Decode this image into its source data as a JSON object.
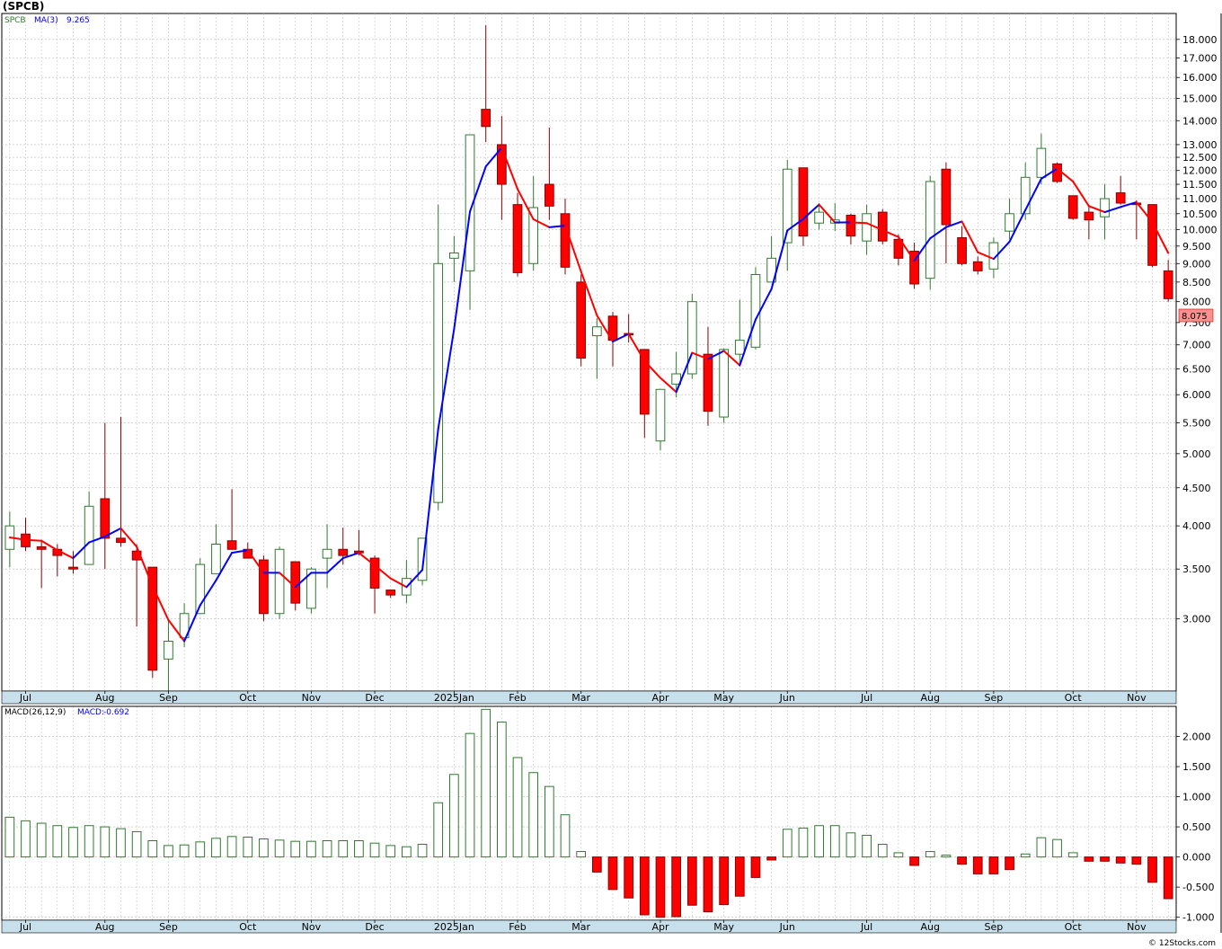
{
  "header": {
    "title": "(SPCB)"
  },
  "legend": {
    "symbol": "SPCB",
    "ma_label": "MA(3)",
    "ma_value": "9.265"
  },
  "macd_legend": {
    "label": "MACD(26,12,9)",
    "macd_label": "MACD:",
    "macd_value": "-0.692"
  },
  "last_price_label": "8.075",
  "footer": {
    "credit": "© 12Stocks.com"
  },
  "colors": {
    "up": "#2f7a2f",
    "down": "#ff0000",
    "ma_up": "#0000ff",
    "ma_down": "#ff0000",
    "grid": "#bbbbbb",
    "axis_bar": "#c8e0ec",
    "price_tag": "#ff9090"
  },
  "chart_data": [
    {
      "type": "candlestick",
      "title": "(SPCB)",
      "scale": "log",
      "ylim": [
        2.4,
        19.5
      ],
      "y_ticks": [
        "3.000",
        "3.500",
        "4.000",
        "4.500",
        "5.000",
        "5.500",
        "6.000",
        "6.500",
        "7.000",
        "7.500",
        "8.000",
        "8.500",
        "9.000",
        "9.500",
        "10.000",
        "10.500",
        "11.000",
        "11.500",
        "12.000",
        "12.500",
        "13.000",
        "14.000",
        "15.000",
        "16.000",
        "17.000",
        "18.000"
      ],
      "x_month_labels": [
        "Jul",
        "Aug",
        "Sep",
        "Oct",
        "Nov",
        "Dec",
        "2025Jan",
        "Feb",
        "Mar",
        "Apr",
        "May",
        "Jun",
        "Jul",
        "Aug",
        "Sep",
        "Oct",
        "Nov"
      ],
      "x_month_week_index": [
        1,
        6,
        10,
        15,
        19,
        23,
        28,
        32,
        36,
        41,
        45,
        49,
        54,
        58,
        62,
        67,
        71
      ],
      "grid": true,
      "series": [
        {
          "name": "SPCB",
          "ohlc": [
            [
              3.72,
              4.18,
              3.52,
              4.0
            ],
            [
              3.9,
              4.1,
              3.7,
              3.75
            ],
            [
              3.75,
              3.83,
              3.3,
              3.72
            ],
            [
              3.72,
              3.78,
              3.42,
              3.65
            ],
            [
              3.52,
              3.7,
              3.45,
              3.5
            ],
            [
              3.55,
              4.45,
              3.55,
              4.25
            ],
            [
              4.35,
              5.5,
              3.5,
              3.85
            ],
            [
              3.85,
              5.6,
              3.75,
              3.8
            ],
            [
              3.7,
              3.78,
              2.93,
              3.6
            ],
            [
              3.52,
              3.52,
              2.5,
              2.56
            ],
            [
              2.65,
              3.0,
              2.4,
              2.8
            ],
            [
              2.83,
              3.15,
              2.75,
              3.05
            ],
            [
              3.05,
              3.62,
              3.05,
              3.55
            ],
            [
              3.45,
              4.02,
              3.45,
              3.78
            ],
            [
              3.82,
              4.48,
              3.72,
              3.72
            ],
            [
              3.72,
              3.8,
              3.65,
              3.62
            ],
            [
              3.6,
              3.65,
              2.98,
              3.05
            ],
            [
              3.05,
              3.75,
              3.0,
              3.72
            ],
            [
              3.58,
              3.58,
              3.08,
              3.15
            ],
            [
              3.1,
              3.52,
              3.05,
              3.5
            ],
            [
              3.62,
              4.02,
              3.3,
              3.72
            ],
            [
              3.72,
              3.98,
              3.55,
              3.65
            ],
            [
              3.7,
              3.95,
              3.65,
              3.68
            ],
            [
              3.62,
              3.65,
              3.05,
              3.3
            ],
            [
              3.28,
              3.28,
              3.2,
              3.23
            ],
            [
              3.23,
              3.6,
              3.15,
              3.4
            ],
            [
              3.38,
              3.85,
              3.33,
              3.85
            ],
            [
              4.3,
              10.8,
              4.2,
              9.0
            ],
            [
              9.15,
              9.8,
              8.5,
              9.3
            ],
            [
              8.8,
              13.4,
              7.8,
              13.4
            ],
            [
              14.5,
              18.8,
              13.1,
              13.75
            ],
            [
              13.0,
              14.2,
              10.3,
              11.5
            ],
            [
              10.8,
              11.2,
              8.65,
              8.75
            ],
            [
              9.0,
              11.8,
              8.8,
              10.7
            ],
            [
              11.5,
              13.7,
              10.3,
              10.75
            ],
            [
              10.5,
              11.0,
              8.7,
              8.9
            ],
            [
              8.5,
              8.7,
              6.55,
              6.72
            ],
            [
              7.2,
              7.6,
              6.3,
              7.4
            ],
            [
              7.65,
              7.75,
              6.55,
              7.1
            ],
            [
              7.25,
              7.7,
              7.05,
              7.22
            ],
            [
              6.9,
              6.9,
              5.25,
              5.65
            ],
            [
              5.2,
              6.1,
              5.05,
              6.1
            ],
            [
              6.2,
              6.85,
              5.95,
              6.4
            ],
            [
              6.4,
              8.2,
              6.3,
              8.0
            ],
            [
              6.8,
              7.4,
              5.45,
              5.7
            ],
            [
              5.6,
              6.92,
              5.5,
              6.9
            ],
            [
              6.8,
              8.05,
              6.55,
              7.1
            ],
            [
              6.95,
              8.9,
              6.9,
              8.7
            ],
            [
              8.5,
              9.8,
              8.5,
              9.15
            ],
            [
              9.6,
              12.4,
              8.8,
              12.05
            ],
            [
              12.1,
              12.1,
              9.5,
              9.8
            ],
            [
              10.2,
              10.85,
              10.0,
              10.55
            ],
            [
              10.2,
              10.85,
              9.95,
              10.3
            ],
            [
              10.45,
              10.5,
              9.55,
              9.8
            ],
            [
              9.65,
              10.8,
              9.25,
              10.5
            ],
            [
              10.55,
              10.65,
              9.55,
              9.65
            ],
            [
              9.7,
              9.85,
              8.95,
              9.15
            ],
            [
              9.35,
              9.6,
              8.32,
              8.45
            ],
            [
              8.6,
              11.8,
              8.3,
              11.6
            ],
            [
              12.05,
              12.3,
              9.0,
              10.15
            ],
            [
              9.75,
              10.1,
              8.95,
              9.0
            ],
            [
              9.05,
              9.2,
              8.7,
              8.8
            ],
            [
              8.85,
              9.75,
              8.6,
              9.6
            ],
            [
              9.95,
              11.0,
              9.7,
              10.5
            ],
            [
              10.5,
              12.3,
              10.3,
              11.75
            ],
            [
              11.75,
              13.45,
              11.5,
              12.85
            ],
            [
              12.25,
              12.3,
              11.55,
              11.6
            ],
            [
              11.1,
              11.1,
              10.3,
              10.35
            ],
            [
              10.55,
              10.75,
              9.7,
              10.3
            ],
            [
              10.4,
              11.5,
              9.7,
              11.0
            ],
            [
              11.2,
              11.8,
              10.8,
              10.85
            ],
            [
              10.85,
              10.95,
              9.7,
              10.8
            ],
            [
              10.8,
              10.8,
              8.9,
              8.95
            ],
            [
              8.8,
              9.1,
              8.0,
              8.075
            ]
          ]
        },
        {
          "name": "MA(3)",
          "values": [
            3.86,
            3.83,
            3.82,
            3.71,
            3.62,
            3.8,
            3.87,
            3.97,
            3.75,
            3.32,
            2.99,
            2.8,
            3.13,
            3.38,
            3.68,
            3.71,
            3.46,
            3.46,
            3.31,
            3.46,
            3.46,
            3.62,
            3.68,
            3.54,
            3.4,
            3.31,
            3.49,
            5.4,
            7.35,
            10.57,
            12.15,
            12.88,
            11.33,
            10.32,
            10.07,
            10.12,
            8.78,
            7.67,
            7.07,
            7.24,
            6.66,
            6.32,
            6.05,
            6.83,
            6.7,
            6.87,
            6.57,
            7.57,
            8.32,
            9.97,
            10.33,
            10.8,
            10.22,
            10.22,
            10.2,
            9.98,
            9.77,
            9.08,
            9.73,
            10.07,
            10.25,
            9.32,
            9.13,
            9.63,
            10.62,
            11.7,
            12.07,
            11.6,
            10.75,
            10.55,
            10.72,
            10.88,
            10.23,
            9.3
          ]
        }
      ]
    },
    {
      "type": "bar",
      "title": "MACD(26,12,9)",
      "ylim": [
        -1.05,
        2.5
      ],
      "y_ticks": [
        "2.000",
        "1.500",
        "1.000",
        "0.500",
        "0.000",
        "-0.500",
        "-1.000"
      ],
      "x_month_labels": [
        "Jul",
        "Aug",
        "Sep",
        "Oct",
        "Nov",
        "Dec",
        "2025Jan",
        "Feb",
        "Mar",
        "Apr",
        "May",
        "Jun",
        "Jul",
        "Aug",
        "Sep",
        "Oct",
        "Nov"
      ],
      "grid": true,
      "series": [
        {
          "name": "MACD",
          "values": [
            0.66,
            0.6,
            0.56,
            0.52,
            0.49,
            0.52,
            0.5,
            0.47,
            0.42,
            0.27,
            0.19,
            0.2,
            0.25,
            0.31,
            0.34,
            0.33,
            0.3,
            0.28,
            0.26,
            0.26,
            0.27,
            0.27,
            0.27,
            0.23,
            0.19,
            0.17,
            0.21,
            0.9,
            1.37,
            2.05,
            2.45,
            2.24,
            1.65,
            1.4,
            1.17,
            0.7,
            0.09,
            -0.25,
            -0.54,
            -0.68,
            -0.96,
            -1.0,
            -0.99,
            -0.8,
            -0.91,
            -0.79,
            -0.65,
            -0.34,
            -0.05,
            0.46,
            0.48,
            0.52,
            0.52,
            0.4,
            0.36,
            0.21,
            0.07,
            -0.14,
            0.09,
            0.03,
            -0.12,
            -0.28,
            -0.28,
            -0.21,
            0.05,
            0.32,
            0.29,
            0.07,
            -0.07,
            -0.07,
            -0.1,
            -0.12,
            -0.42,
            -0.692
          ]
        }
      ]
    }
  ]
}
